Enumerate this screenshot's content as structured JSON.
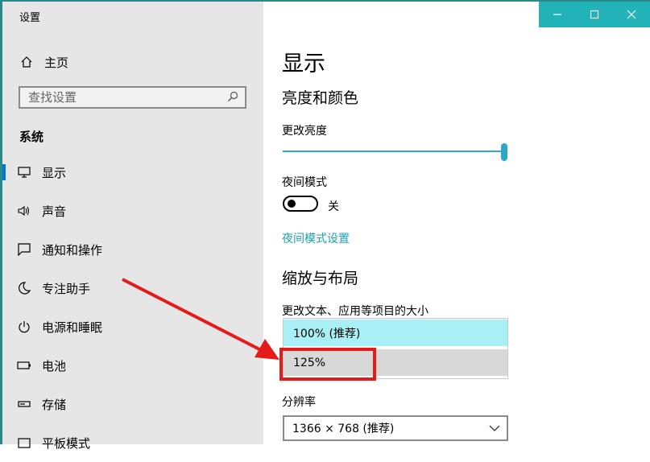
{
  "window": {
    "title": "设置"
  },
  "sidebar": {
    "home": "主页",
    "search_placeholder": "查找设置",
    "section": "系统",
    "items": [
      {
        "label": "显示",
        "icon": "monitor-icon"
      },
      {
        "label": "声音",
        "icon": "speaker-icon"
      },
      {
        "label": "通知和操作",
        "icon": "notification-icon"
      },
      {
        "label": "专注助手",
        "icon": "moon-icon"
      },
      {
        "label": "电源和睡眠",
        "icon": "power-icon"
      },
      {
        "label": "电池",
        "icon": "battery-icon"
      },
      {
        "label": "存储",
        "icon": "storage-icon"
      },
      {
        "label": "平板模式",
        "icon": "tablet-icon"
      }
    ]
  },
  "main": {
    "title": "显示",
    "brightness": {
      "heading": "亮度和颜色",
      "label": "更改亮度",
      "value_fraction": 1.0,
      "night_mode_label": "夜间模式",
      "night_mode_state": "关",
      "night_mode_settings_link": "夜间模式设置"
    },
    "scale": {
      "heading": "缩放与布局",
      "label": "更改文本、应用等项目的大小",
      "options": [
        "100% (推荐)",
        "125%"
      ]
    },
    "resolution": {
      "label": "分辨率",
      "value": "1366 × 768 (推荐)"
    }
  },
  "annotation": {
    "color": "#e51b1b"
  }
}
